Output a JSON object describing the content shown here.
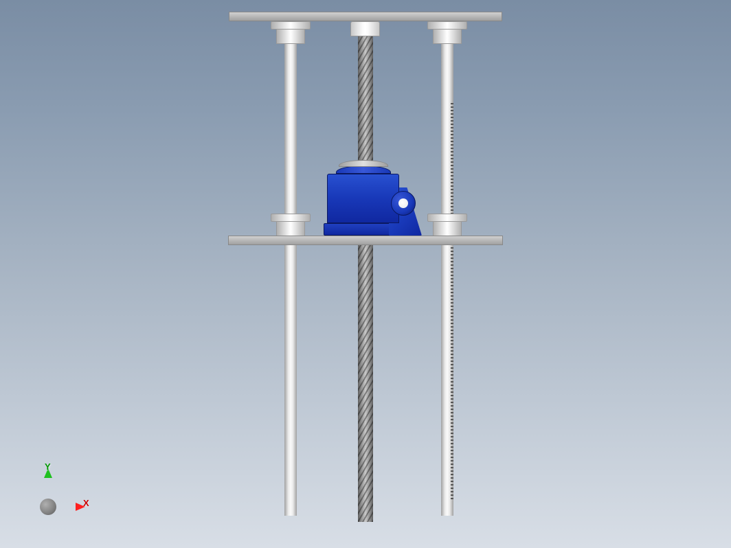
{
  "triad": {
    "x_label": "X",
    "y_label": "Y"
  },
  "model": {
    "parts": {
      "top_plate": "top-plate",
      "mid_plate": "mid-plate",
      "left_guide_rod": "guide-rod-left",
      "right_guide_rod": "guide-rod-right",
      "lead_screw": "lead-screw",
      "gearbox": "worm-gearbox",
      "bushing": "linear-bushing"
    },
    "colors": {
      "gearbox_blue": "#1838b8",
      "metal_light": "#e8e8e8",
      "metal_dark": "#888888"
    }
  }
}
